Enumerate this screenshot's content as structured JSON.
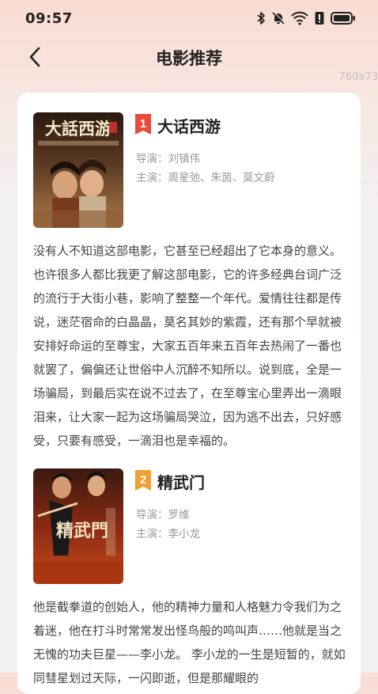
{
  "status_bar": {
    "time": "09:57",
    "battery_icon": "battery-icon",
    "wifi_icon": "wifi-icon",
    "mute_icon": "bell-off-icon",
    "bluetooth_icon": "bluetooth-icon"
  },
  "header": {
    "title": "电影推荐",
    "back_icon": "chevron-left-icon"
  },
  "watermark": "760a73",
  "movies": [
    {
      "rank": "1",
      "title": "大话西游",
      "director_label": "导演：",
      "director": "刘镇伟",
      "cast_label": "主演：",
      "cast": "周星弛、朱茵、莫文蔚",
      "poster_text": "大話西游",
      "description": "没有人不知道这部电影，它甚至已经超出了它本身的意义。也许很多人都比我更了解这部电影，它的许多经典台词广泛的流行于大街小巷，影响了整整一个年代。爱情往往都是传说，迷茫宿命的白晶晶，莫名其妙的紫霞，还有那个早就被安排好命运的至尊宝，大家五百年来五百年去热闹了一番也就罢了，偏偏还让世俗中人沉醉不知所以。说到底，全是一场骗局，到最后实在说不过去了，在至尊宝心里弄出一滴眼泪来，让大家一起为这场骗局哭泣，因为逃不出去，只好感受，只要有感受，一滴泪也是幸福的。"
    },
    {
      "rank": "2",
      "title": "精武门",
      "director_label": "导演：",
      "director": "罗维",
      "cast_label": "主演：",
      "cast": "李小龙",
      "poster_text": "精武門",
      "description": "他是截拳道的创始人，他的精神力量和人格魅力令我们为之着迷，他在打斗时常常发出怪鸟般的鸣叫声……他就是当之无愧的功夫巨星——李小龙。 李小龙的一生是短暂的，就如同彗星划过天际，一闪即逝，但是那耀眼的"
    }
  ],
  "colors": {
    "rank1": "#e84a3c",
    "rank2": "#f0a030",
    "accent": "#222222"
  }
}
